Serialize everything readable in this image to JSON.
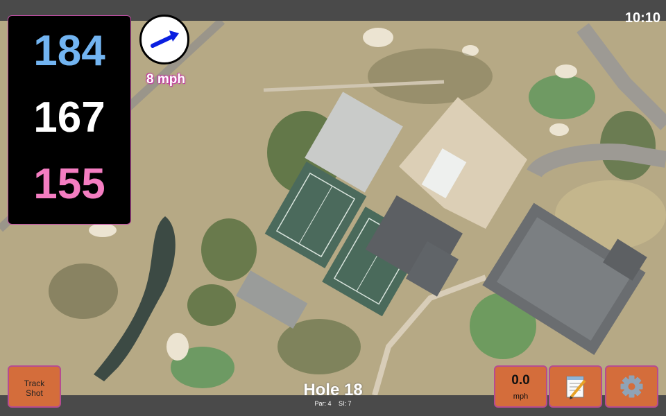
{
  "status": {
    "time": "10:10"
  },
  "yardages": {
    "back": "184",
    "middle": "167",
    "front": "155"
  },
  "wind": {
    "speed": "8 mph",
    "icon": "wind-arrow-icon"
  },
  "buttons": {
    "track_shot": "Track\nShot",
    "speed_value": "0.0",
    "speed_unit": "mph",
    "notes_icon": "notepad-icon",
    "settings_icon": "gear-icon"
  },
  "hole": {
    "title": "Hole 18",
    "par": "Par: 4",
    "si": "SI: 7"
  },
  "colors": {
    "back": "#72b4f1",
    "middle": "#ffffff",
    "front": "#f47dc1",
    "button": "#d46d3b",
    "accent": "#c24ea6"
  }
}
